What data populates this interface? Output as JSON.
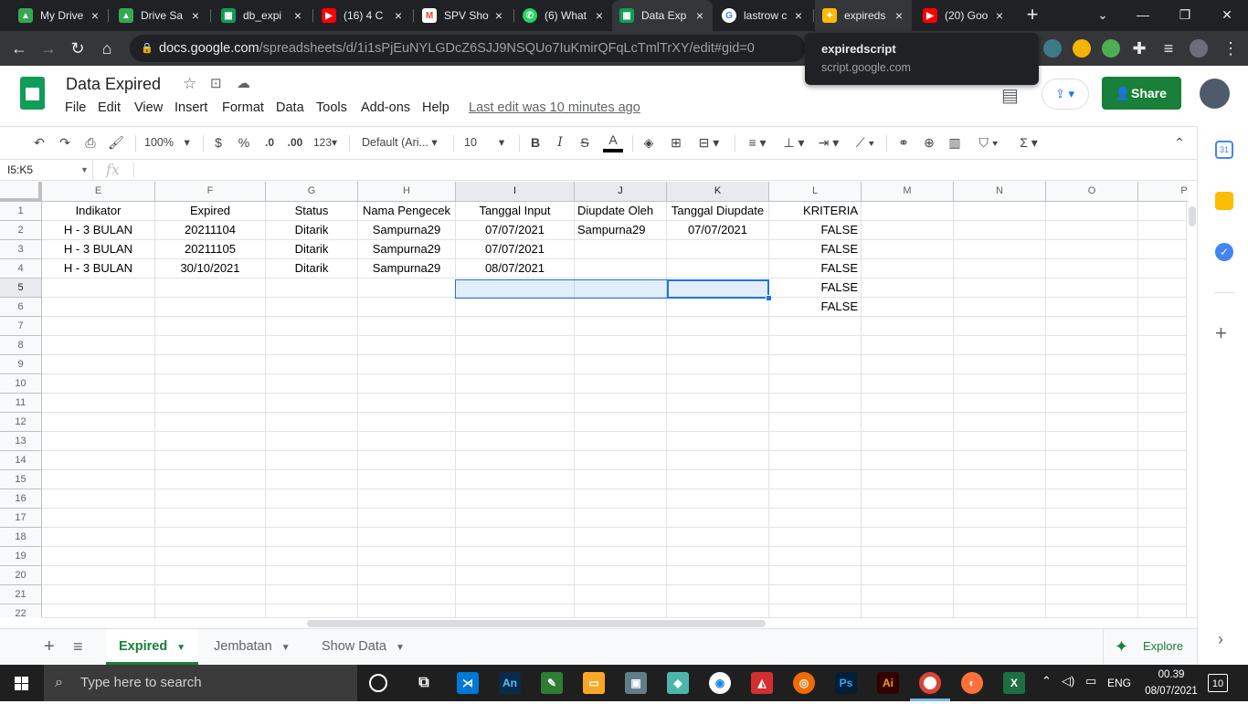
{
  "browser": {
    "tabs": [
      {
        "label": "My Drive",
        "icon": "drive-icon",
        "color": "#34a853"
      },
      {
        "label": "Drive Sa",
        "icon": "drive-icon",
        "color": "#34a853"
      },
      {
        "label": "db_expi",
        "icon": "sheets-icon",
        "color": "#0f9d58"
      },
      {
        "label": "(16) 4 C",
        "icon": "youtube-icon",
        "color": "#ff0000"
      },
      {
        "label": "SPV Sho",
        "icon": "gmail-icon",
        "color": "#ea4335"
      },
      {
        "label": "(6) What",
        "icon": "whatsapp-icon",
        "color": "#25d366"
      },
      {
        "label": "Data Exp",
        "icon": "sheets-icon",
        "color": "#0f9d58"
      },
      {
        "label": "lastrow c",
        "icon": "google-icon",
        "color": "#4285f4"
      },
      {
        "label": "expireds",
        "icon": "apps-script-icon",
        "color": "#fbbc04"
      },
      {
        "label": "(20) Goo",
        "icon": "youtube-icon",
        "color": "#ff0000"
      }
    ],
    "url_host": "docs.google.com",
    "url_path": "/spreadsheets/d/1i1sPjEuNYLGDcZ6SJJ9NSQUo7IuKmirQFqLcTmlTrXY/edit#gid=0",
    "tooltip_title": "expiredscript",
    "tooltip_url": "script.google.com"
  },
  "sheets": {
    "title": "Data Expired",
    "menus": [
      "File",
      "Edit",
      "View",
      "Insert",
      "Format",
      "Data",
      "Tools",
      "Add-ons",
      "Help"
    ],
    "last_edit": "Last edit was 10 minutes ago",
    "share_label": "Share",
    "zoom": "100%",
    "currency": "$",
    "percent": "%",
    "dec_less": ".0",
    "dec_more": ".00",
    "num_format": "123",
    "font": "Default (Ari...",
    "font_size": "10",
    "name_box": "I5:K5",
    "fx": "fx",
    "columns": [
      "E",
      "F",
      "G",
      "H",
      "I",
      "J",
      "K",
      "L",
      "M",
      "N",
      "O",
      "P"
    ],
    "rows": [
      "1",
      "2",
      "3",
      "4",
      "5",
      "6",
      "7",
      "8",
      "9",
      "10",
      "11",
      "12",
      "13",
      "14",
      "15",
      "16",
      "17",
      "18",
      "19",
      "20",
      "21",
      "22"
    ],
    "cells": [
      [
        "Indikator",
        "Expired",
        "Status",
        "Nama Pengecek",
        "Tanggal Input",
        "Diupdate Oleh",
        "Tanggal Diupdate",
        "KRITERIA"
      ],
      [
        "H - 3 BULAN",
        "20211104",
        "Ditarik",
        "Sampurna29",
        "07/07/2021",
        "Sampurna29",
        "07/07/2021",
        "FALSE"
      ],
      [
        "H - 3 BULAN",
        "20211105",
        "Ditarik",
        "Sampurna29",
        "07/07/2021",
        "",
        "",
        "FALSE"
      ],
      [
        "H - 3 BULAN",
        "30/10/2021",
        "Ditarik",
        "Sampurna29",
        "08/07/2021",
        "",
        "",
        "FALSE"
      ],
      [
        "",
        "",
        "",
        "",
        "",
        "",
        "",
        "FALSE"
      ],
      [
        "",
        "",
        "",
        "",
        "",
        "",
        "",
        "FALSE"
      ]
    ],
    "sheet_tabs": [
      "Expired",
      "Jembatan",
      "Show Data"
    ],
    "active_sheet": "Expired",
    "explore_label": "Explore"
  },
  "taskbar": {
    "search_placeholder": "Type here to search",
    "lang": "ENG",
    "time": "00.39",
    "date": "08/07/2021",
    "notifications": "10"
  }
}
